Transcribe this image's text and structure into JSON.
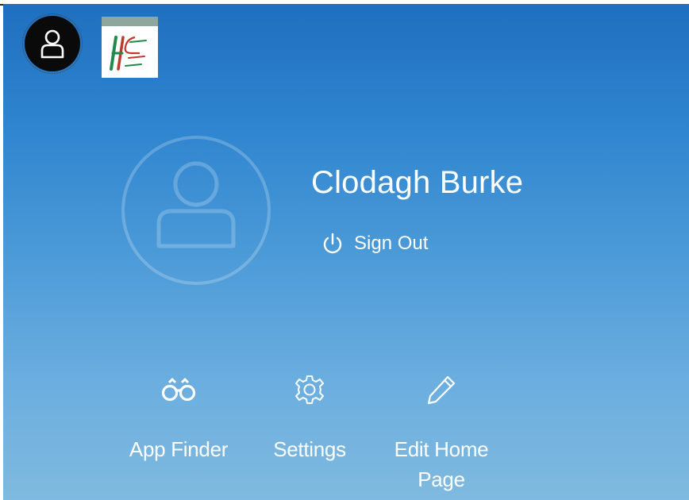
{
  "header": {
    "avatar_icon": "person-icon",
    "logo_text": "HSE"
  },
  "profile": {
    "name": "Clodagh Burke",
    "sign_out_label": "Sign Out",
    "sign_out_icon": "power-icon",
    "avatar_icon": "person-icon"
  },
  "actions": [
    {
      "label": "App Finder",
      "icon": "binoculars-icon"
    },
    {
      "label": "Settings",
      "icon": "gear-icon"
    },
    {
      "label": "Edit Home Page",
      "icon": "pencil-icon"
    }
  ],
  "colors": {
    "panel_top": "#1f6fc0",
    "panel_bottom": "#7fbadf",
    "text": "#ffffff"
  }
}
